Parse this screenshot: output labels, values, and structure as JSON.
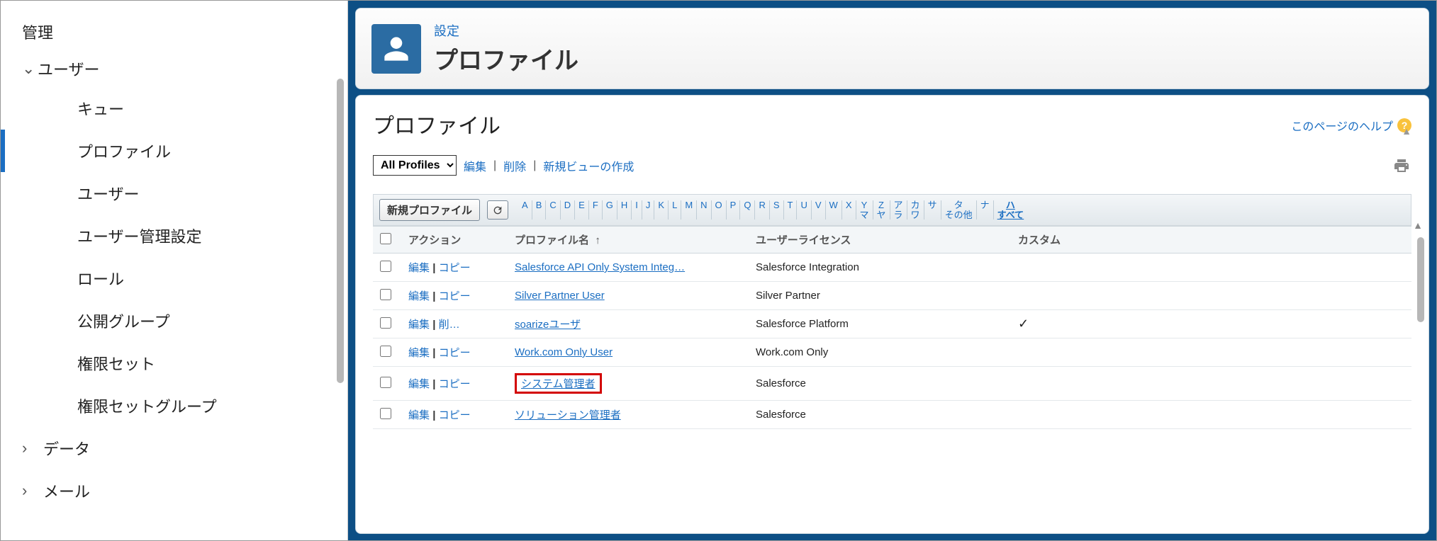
{
  "sidebar": {
    "section": "管理",
    "users_label": "ユーザー",
    "children": [
      {
        "label": "キュー"
      },
      {
        "label": "プロファイル"
      },
      {
        "label": "ユーザー"
      },
      {
        "label": "ユーザー管理設定"
      },
      {
        "label": "ロール"
      },
      {
        "label": "公開グループ"
      },
      {
        "label": "権限セット"
      },
      {
        "label": "権限セットグループ"
      }
    ],
    "data_label": "データ",
    "mail_label": "メール"
  },
  "header": {
    "sub": "設定",
    "title": "プロファイル"
  },
  "page": {
    "heading": "プロファイル",
    "help": "このページのヘルプ",
    "view": {
      "selected": "All Profiles",
      "edit": "編集",
      "del": "削除",
      "create": "新規ビューの作成"
    },
    "new_profile": "新規プロファイル"
  },
  "alpha": {
    "latin": [
      "A",
      "B",
      "C",
      "D",
      "E",
      "F",
      "G",
      "H",
      "I",
      "J",
      "K",
      "L",
      "M",
      "N",
      "O",
      "P",
      "Q",
      "R",
      "S",
      "T",
      "U",
      "V",
      "W",
      "X"
    ],
    "stacks": [
      [
        "Y",
        "マ"
      ],
      [
        "Z",
        "ヤ"
      ],
      [
        "ア",
        "ラ"
      ],
      [
        "カ",
        "ワ"
      ],
      [
        "サ",
        ""
      ],
      [
        "タ",
        "その他"
      ],
      [
        "ナ",
        ""
      ],
      [
        "ハ",
        "すべて"
      ]
    ]
  },
  "table": {
    "headers": {
      "action": "アクション",
      "name": "プロファイル名",
      "license": "ユーザーライセンス",
      "custom": "カスタム"
    },
    "rows": [
      {
        "a1": "編集",
        "a2": "コピー",
        "name": "Salesforce API Only System Integ…",
        "license": "Salesforce Integration",
        "custom": false,
        "hl": false
      },
      {
        "a1": "編集",
        "a2": "コピー",
        "name": "Silver Partner User",
        "license": "Silver Partner",
        "custom": false,
        "hl": false
      },
      {
        "a1": "編集",
        "a2": "削…",
        "name": "soarizeユーザ",
        "license": "Salesforce Platform",
        "custom": true,
        "hl": false
      },
      {
        "a1": "編集",
        "a2": "コピー",
        "name": "Work.com Only User",
        "license": "Work.com Only",
        "custom": false,
        "hl": false
      },
      {
        "a1": "編集",
        "a2": "コピー",
        "name": "システム管理者",
        "license": "Salesforce",
        "custom": false,
        "hl": true
      },
      {
        "a1": "編集",
        "a2": "コピー",
        "name": "ソリューション管理者",
        "license": "Salesforce",
        "custom": false,
        "hl": false
      }
    ]
  }
}
